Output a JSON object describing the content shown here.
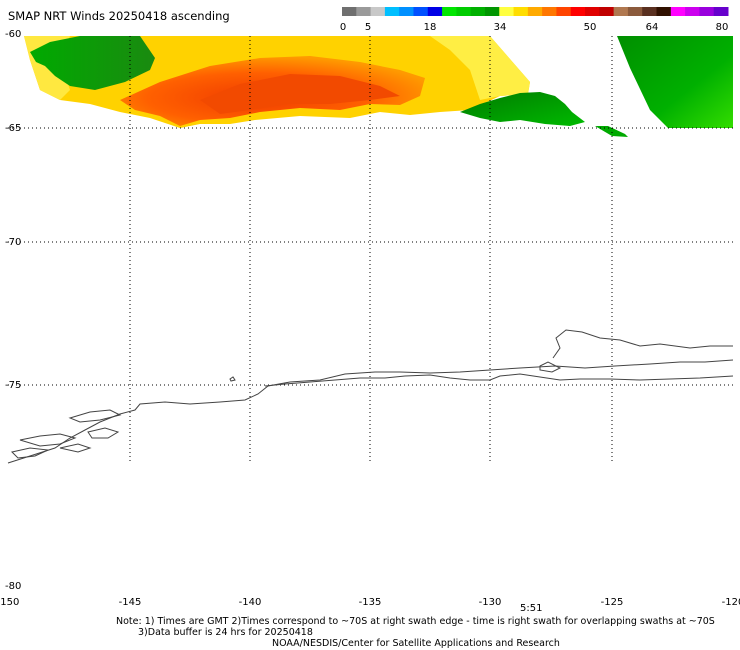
{
  "title": "SMAP NRT Winds 20250418 ascending",
  "colorbar": {
    "tick_labels": [
      "0",
      "5",
      "18",
      "34",
      "50",
      "64",
      "80"
    ],
    "segments": [
      {
        "color": "#6f6f6f"
      },
      {
        "color": "#9a9a9a"
      },
      {
        "color": "#c8c8c8"
      },
      {
        "color": "#00bfff"
      },
      {
        "color": "#0090ff"
      },
      {
        "color": "#0050ff"
      },
      {
        "color": "#0000e6"
      },
      {
        "color": "#00e600"
      },
      {
        "color": "#00cc00"
      },
      {
        "color": "#00b000"
      },
      {
        "color": "#009600"
      },
      {
        "color": "#ffff40"
      },
      {
        "color": "#ffdd00"
      },
      {
        "color": "#ffaa00"
      },
      {
        "color": "#ff7700"
      },
      {
        "color": "#ff4400"
      },
      {
        "color": "#ff0000"
      },
      {
        "color": "#e00000"
      },
      {
        "color": "#c00000"
      },
      {
        "color": "#b07850"
      },
      {
        "color": "#8b5a3c"
      },
      {
        "color": "#5a3020"
      },
      {
        "color": "#301000"
      },
      {
        "color": "#ff00ff"
      },
      {
        "color": "#cc00ee"
      },
      {
        "color": "#9900dd"
      },
      {
        "color": "#6600cc"
      }
    ]
  },
  "lat_labels": [
    "-60",
    "-65",
    "-70",
    "-75",
    "-80"
  ],
  "lon_labels": [
    "-150",
    "-145",
    "-140",
    "-135",
    "-130",
    "-125",
    "-120"
  ],
  "time_label": "5:51",
  "notes": [
    "Note: 1) Times are GMT 2)Times correspond to ~70S at right swath edge - time is right swath for overlapping swaths at ~70S",
    "3)Data buffer is 24 hrs for 20250418",
    "NOAA/NESDIS/Center for Satellite Applications and Research"
  ],
  "colors": {
    "swath_yellow": "#ffd000",
    "swath_light_yellow": "#ffee40",
    "swath_orange": "#ff6a00",
    "swath_dark_orange": "#f04000",
    "swath_green": "#009900",
    "swath_light_green": "#22cc00",
    "coastline": "#444444",
    "grid": "#000000"
  }
}
